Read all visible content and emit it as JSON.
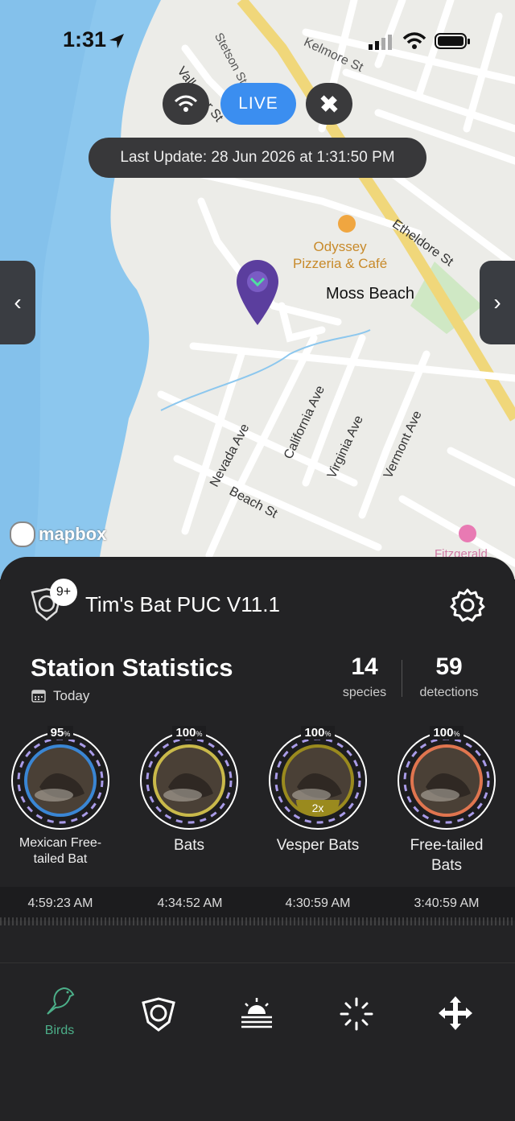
{
  "status_bar": {
    "time": "1:31"
  },
  "map": {
    "live_label": "LIVE",
    "last_update": "Last Update: 28 Jun 2026 at 1:31:50 PM",
    "streets": [
      "Stetson St",
      "Kelmore St",
      "Vallemar St",
      "Etheldore St",
      "Nevada Ave",
      "California Ave",
      "Virginia Ave",
      "Vermont Ave",
      "Beach St"
    ],
    "poi": "Odyssey\nPizzeria & Café",
    "place": "Moss Beach",
    "attribution": "mapbox",
    "partial_label": "Fitzgerald"
  },
  "station": {
    "badge": "9+",
    "name": "Tim's Bat PUC V11.1"
  },
  "stats": {
    "title": "Station Statistics",
    "period": "Today",
    "species_count": "14",
    "species_label": "species",
    "detections_count": "59",
    "detections_label": "detections"
  },
  "cards": [
    {
      "pct": "95",
      "name": "Mexican Free-\ntailed Bat",
      "time": "4:59:23 AM",
      "color": "#3a86d4"
    },
    {
      "pct": "100",
      "name": "Bats",
      "time": "4:34:52 AM",
      "color": "#c9b94a"
    },
    {
      "pct": "100",
      "name": "Vesper Bats",
      "time": "4:30:59 AM",
      "color": "#9a8a1e",
      "multiplier": "2x"
    },
    {
      "pct": "100",
      "name": "Free-tailed\nBats",
      "time": "3:40:59 AM",
      "color": "#e0754f"
    }
  ],
  "tabs": {
    "birds_label": "Birds"
  }
}
